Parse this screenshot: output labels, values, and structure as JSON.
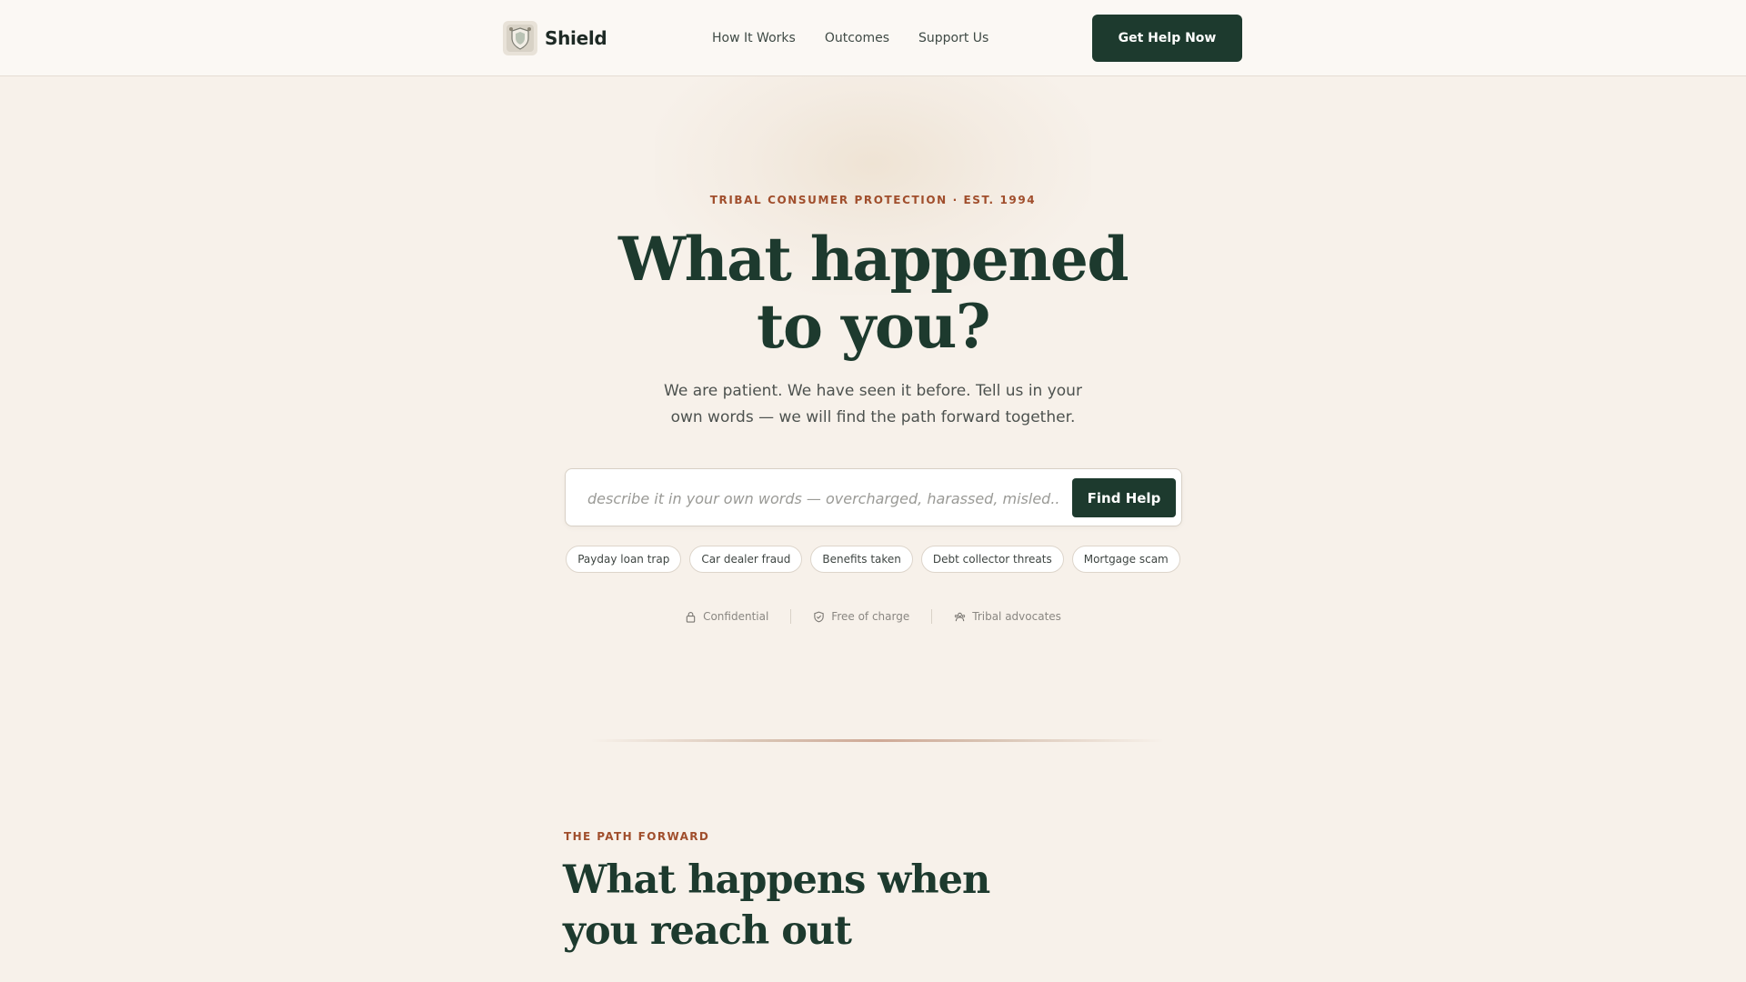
{
  "header": {
    "brand_name": "Shield",
    "nav": [
      {
        "label": "How It Works"
      },
      {
        "label": "Outcomes"
      },
      {
        "label": "Support Us"
      }
    ],
    "cta_label": "Get Help Now"
  },
  "hero": {
    "eyebrow": "TRIBAL CONSUMER PROTECTION · EST. 1994",
    "title_line1": "What happened",
    "title_line2": "to you?",
    "subtitle": "We are patient. We have seen it before. Tell us in your own words — we will find the path forward together."
  },
  "search": {
    "placeholder": "describe it in your own words — overcharged, harassed, misled...",
    "value": "",
    "button_label": "Find Help"
  },
  "chips": [
    {
      "label": "Payday loan trap"
    },
    {
      "label": "Car dealer fraud"
    },
    {
      "label": "Benefits taken"
    },
    {
      "label": "Debt collector threats"
    },
    {
      "label": "Mortgage scam"
    }
  ],
  "trust": [
    {
      "label": "Confidential",
      "icon": "lock-icon"
    },
    {
      "label": "Free of charge",
      "icon": "shield-check-icon"
    },
    {
      "label": "Tribal advocates",
      "icon": "people-icon"
    }
  ],
  "section": {
    "eyebrow": "THE PATH FORWARD",
    "title_line1": "What happens when",
    "title_line2": "you reach out"
  },
  "colors": {
    "primary": "#1d3a2e",
    "accent": "#a04e2c",
    "background": "#f7f1ea"
  }
}
